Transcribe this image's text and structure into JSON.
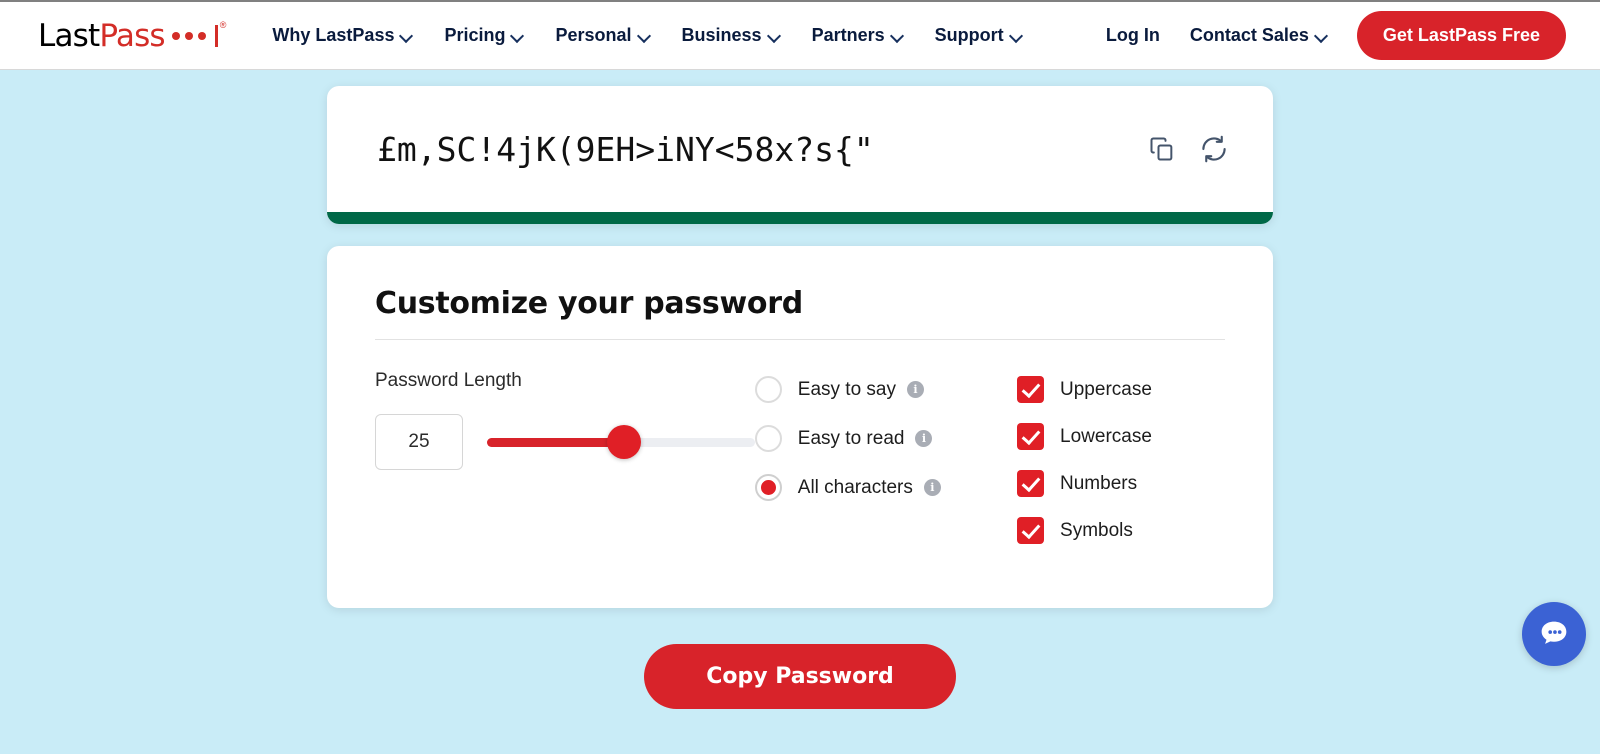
{
  "nav": {
    "logo": {
      "part1": "Last",
      "part2": "Pass",
      "registered": "®"
    },
    "links": [
      {
        "label": "Why LastPass",
        "icon": "chevron-down-icon"
      },
      {
        "label": "Pricing",
        "icon": "chevron-down-icon"
      },
      {
        "label": "Personal",
        "icon": "chevron-down-icon"
      },
      {
        "label": "Business",
        "icon": "chevron-down-icon"
      },
      {
        "label": "Partners",
        "icon": "chevron-down-icon"
      },
      {
        "label": "Support",
        "icon": "chevron-down-icon"
      }
    ],
    "login_label": "Log In",
    "contact_label": "Contact Sales",
    "cta_label": "Get LastPass Free"
  },
  "generator": {
    "password": "£m,SC!4jK(9EH>iNY<58x?s{\"",
    "copy_icon": "copy-icon",
    "refresh_icon": "refresh-icon",
    "strength_color": "#006847"
  },
  "customize": {
    "title": "Customize your password",
    "length_label": "Password Length",
    "length_value": "25",
    "slider": {
      "percent": 51,
      "min": "1",
      "max": "50",
      "accent": "#d8232a"
    },
    "radios": [
      {
        "label": "Easy to say",
        "checked": false,
        "info": "i"
      },
      {
        "label": "Easy to read",
        "checked": false,
        "info": "i"
      },
      {
        "label": "All characters",
        "checked": true,
        "info": "i"
      }
    ],
    "checkboxes": [
      {
        "label": "Uppercase",
        "checked": true
      },
      {
        "label": "Lowercase",
        "checked": true
      },
      {
        "label": "Numbers",
        "checked": true
      },
      {
        "label": "Symbols",
        "checked": true
      }
    ]
  },
  "actions": {
    "copy_password_label": "Copy Password"
  },
  "chat": {
    "icon": "chat-bubble-icon"
  }
}
